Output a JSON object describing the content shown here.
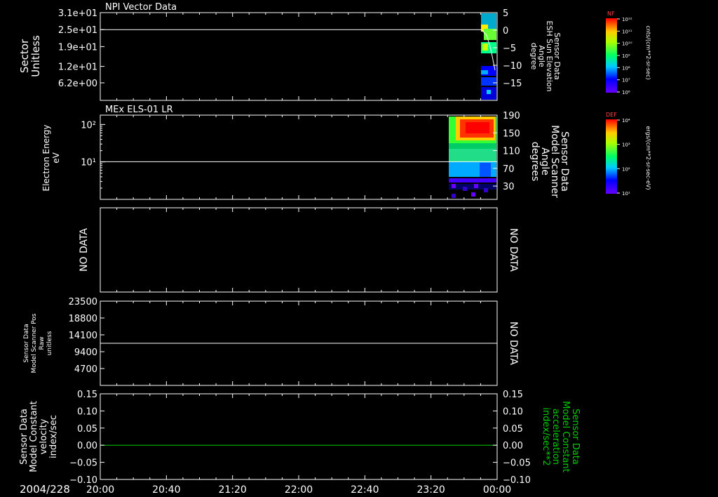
{
  "colors": {
    "background": "#000000",
    "foreground": "#ffffff",
    "accent_line": "#00cc00"
  },
  "chart_data": [
    {
      "type": "heatmap",
      "title": "NPI Vector Data",
      "ylabel_lines": [
        "Sector",
        "Unitless"
      ],
      "yticks": [
        "3.1e+01",
        "2.5e+01",
        "1.9e+01",
        "1.2e+01",
        "6.2e+00"
      ],
      "ylim": [
        0,
        31
      ],
      "right_ylabel_lines": [
        "Sensor Data",
        "ESH Sun Elevation",
        "Angle",
        "degree"
      ],
      "right_yticks": [
        "5",
        "0",
        "−5",
        "−10",
        "−15"
      ],
      "right_ylim": [
        -20,
        5
      ],
      "colorbar": {
        "label": "NF",
        "unit": "cnts/(cm**2-sr-sec)",
        "ticks": [
          "10¹²",
          "10¹¹",
          "10¹⁰",
          "10⁹",
          "10⁸",
          "10⁷",
          "10⁶"
        ]
      },
      "line_value": 25,
      "data_start_time": "23:50"
    },
    {
      "type": "heatmap",
      "title": "MEx ELS-01 LR",
      "ylabel_lines": [
        "Electron Energy",
        "eV"
      ],
      "yticks": [
        "10²",
        "10¹"
      ],
      "right_ylabel_lines": [
        "Sensor Data",
        "Model Scanner",
        "Angle",
        "degrees"
      ],
      "right_yticks": [
        "190",
        "150",
        "110",
        "70",
        "30"
      ],
      "right_ylim": [
        0,
        190
      ],
      "colorbar": {
        "label": "DEF",
        "unit": "ergs/(cm**2-sr-sec-eV)",
        "ticks": [
          "10⁴",
          "10³",
          "10²",
          "10¹"
        ]
      },
      "line_value": 85,
      "data_start_time": "23:40"
    },
    {
      "type": "line",
      "no_data_left": "NO DATA",
      "no_data_right": "NO DATA"
    },
    {
      "type": "line",
      "ylabel_lines": [
        "Sensor Data",
        "Model Scanner Pos",
        "Raw",
        "unitless"
      ],
      "yticks": [
        "23500",
        "18800",
        "14100",
        "9400",
        "4700"
      ],
      "ylim": [
        0,
        23500
      ],
      "line_value": 11750,
      "no_data_right": "NO DATA"
    },
    {
      "type": "line",
      "ylabel_lines": [
        "Sensor Data",
        "Model Constant",
        "velocity",
        "index/sec"
      ],
      "yticks": [
        "0.15",
        "0.10",
        "0.05",
        "0.00",
        "−0.05",
        "−0.10"
      ],
      "ylim": [
        -0.1,
        0.15
      ],
      "right_ylabel_lines": [
        "Sensor Data",
        "Model Constant",
        "acceleration",
        "index/sec**2"
      ],
      "right_yticks": [
        "0.15",
        "0.10",
        "0.05",
        "0.00",
        "−0.05",
        "−0.10"
      ],
      "line_value": 0.0
    }
  ],
  "time_axis": {
    "date_label": "2004/228",
    "labels": [
      "20:00",
      "20:40",
      "21:20",
      "22:00",
      "22:40",
      "23:20",
      "00:00"
    ]
  }
}
